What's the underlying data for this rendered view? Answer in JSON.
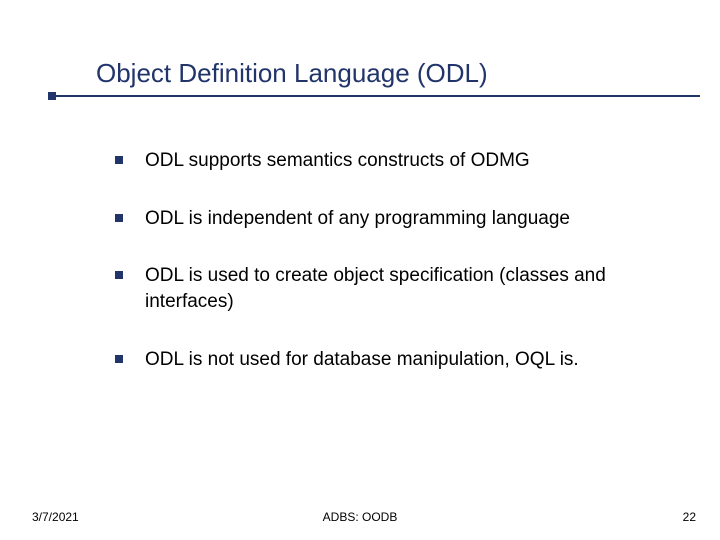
{
  "title": "Object Definition Language (ODL)",
  "bullets": {
    "b0": "ODL supports semantics constructs of ODMG",
    "b1": "ODL is independent of any programming language",
    "b2": "ODL is used to create object specification (classes and interfaces)",
    "b3": "ODL is not used for database manipulation, OQL is."
  },
  "footer": {
    "date": "3/7/2021",
    "center": "ADBS: OODB",
    "page": "22"
  }
}
